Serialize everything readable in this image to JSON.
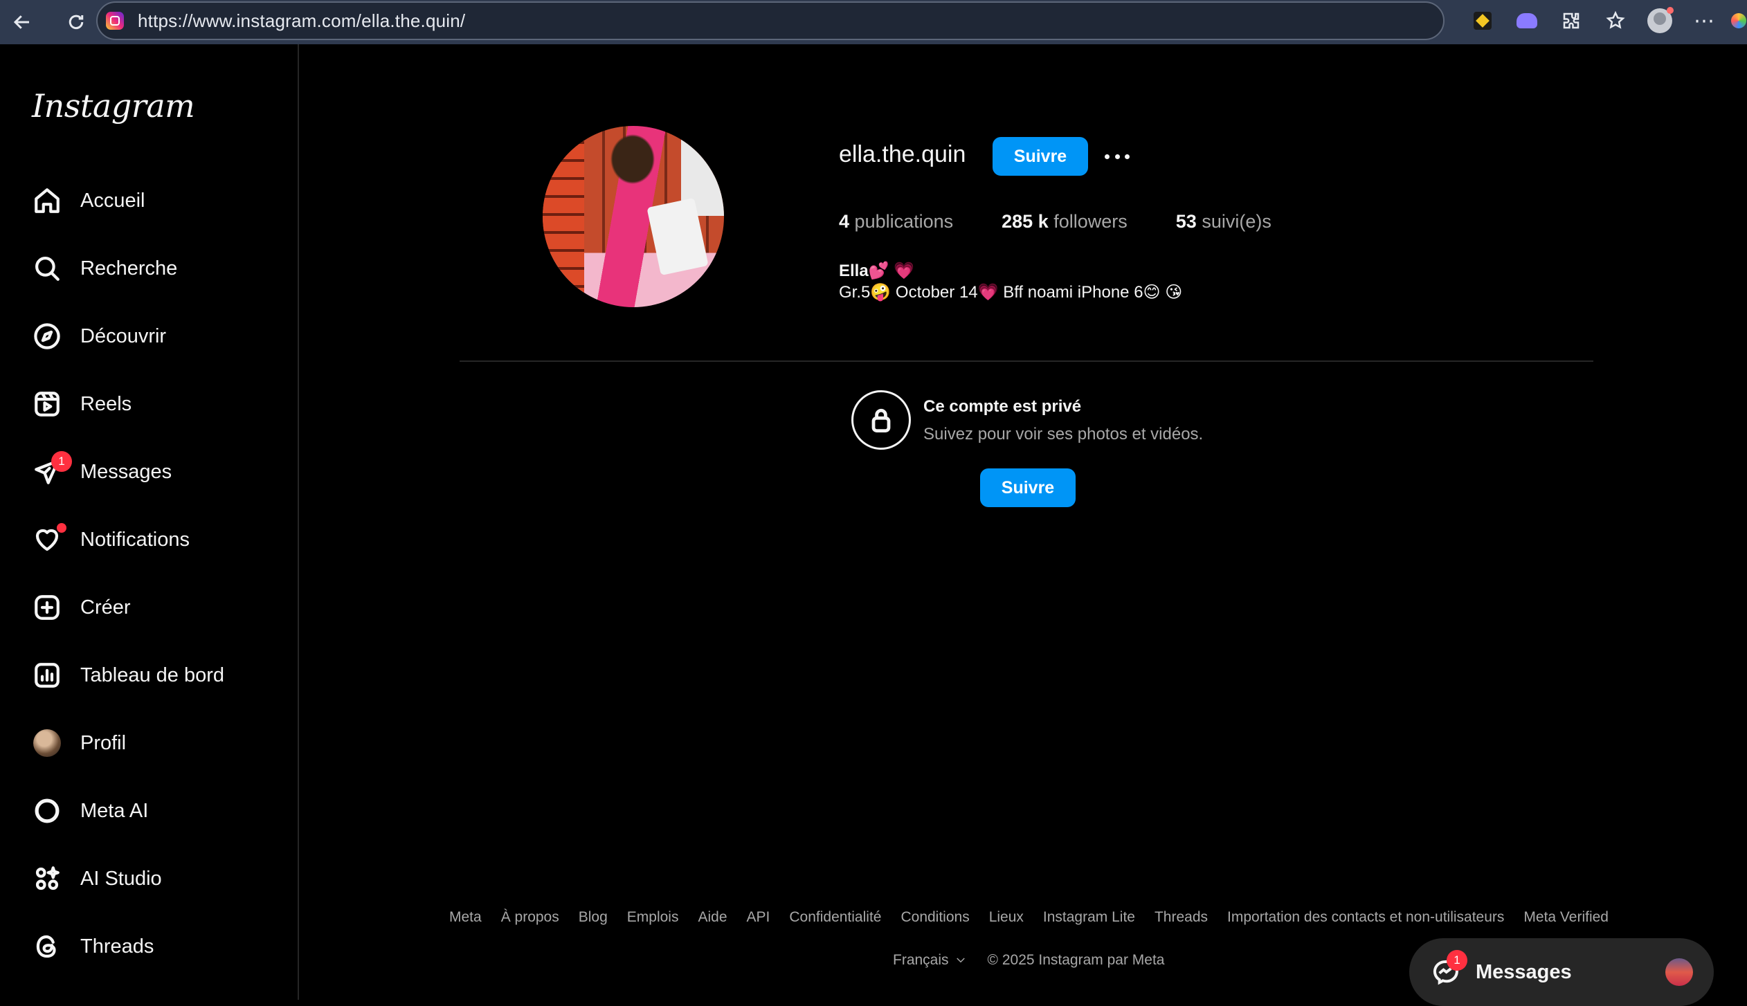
{
  "browser": {
    "url": "https://www.instagram.com/ella.the.quin/",
    "extension_icons": [
      "binance-extension-icon",
      "ghost-extension-icon",
      "puzzle-extensions-icon",
      "favorites-icon",
      "profile-avatar-icon",
      "more-icon",
      "copilot-icon"
    ]
  },
  "sidebar": {
    "logo": "Instagram",
    "items": [
      {
        "label": "Accueil",
        "icon": "home-icon"
      },
      {
        "label": "Recherche",
        "icon": "search-icon"
      },
      {
        "label": "Découvrir",
        "icon": "compass-icon"
      },
      {
        "label": "Reels",
        "icon": "reels-icon"
      },
      {
        "label": "Messages",
        "icon": "direct-icon",
        "badge": "1"
      },
      {
        "label": "Notifications",
        "icon": "heart-icon"
      },
      {
        "label": "Créer",
        "icon": "create-icon"
      },
      {
        "label": "Tableau de bord",
        "icon": "dashboard-icon"
      },
      {
        "label": "Profil",
        "icon": "profile-avatar"
      },
      {
        "label": "Meta AI",
        "icon": "meta-ai-icon"
      },
      {
        "label": "AI Studio",
        "icon": "ai-studio-icon"
      },
      {
        "label": "Threads",
        "icon": "threads-icon"
      }
    ]
  },
  "profile": {
    "username": "ella.the.quin",
    "follow_label": "Suivre",
    "stats": {
      "posts_count": "4",
      "posts_label": "publications",
      "followers_count": "285 k",
      "followers_label": "followers",
      "following_count": "53",
      "following_label": "suivi(e)s"
    },
    "bio_name": "Ella💕 💗",
    "bio_text": "Gr.5🤪 October 14💗 Bff noami iPhone 6😊 😘"
  },
  "private": {
    "title": "Ce compte est privé",
    "subtitle": "Suivez pour voir ses photos et vidéos.",
    "follow_label": "Suivre"
  },
  "footer": {
    "links": [
      "Meta",
      "À propos",
      "Blog",
      "Emplois",
      "Aide",
      "API",
      "Confidentialité",
      "Conditions",
      "Lieux",
      "Instagram Lite",
      "Threads",
      "Importation des contacts et non-utilisateurs",
      "Meta Verified"
    ],
    "language": "Français",
    "copyright": "© 2025 Instagram par Meta"
  },
  "floating_messages": {
    "label": "Messages",
    "badge": "1"
  },
  "colors": {
    "accent": "#0095f6",
    "badge": "#ff3040",
    "background": "#000000",
    "secondary_text": "#a8a8a8"
  }
}
